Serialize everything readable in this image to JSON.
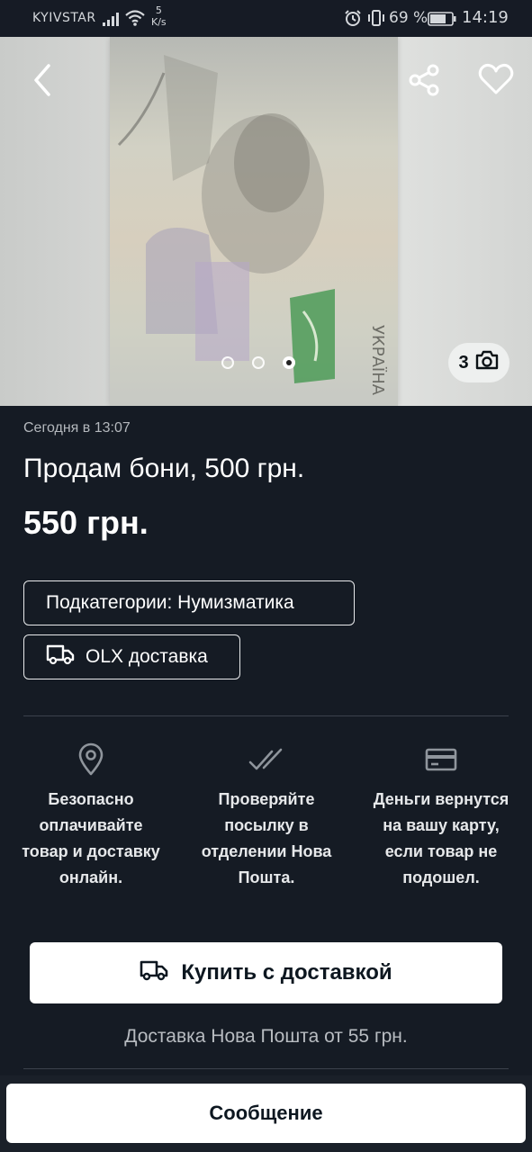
{
  "status_bar": {
    "carrier": "KYIVSTAR",
    "net_speed_value": "5",
    "net_speed_unit": "K/s",
    "battery_percent": "69 %",
    "time": "14:19"
  },
  "gallery": {
    "photo_count": "3",
    "current_index": 3,
    "total_dots": 3,
    "icons": {
      "back": "chevron-left-icon",
      "share": "share-icon",
      "favorite": "heart-icon",
      "camera": "camera-icon"
    }
  },
  "listing": {
    "posted": "Сегодня в 13:07",
    "title": "Продам бони, 500 грн.",
    "price": "550 грн."
  },
  "chips": {
    "category": "Подкатегории: Нумизматика",
    "delivery": "OLX доставка"
  },
  "features": [
    {
      "icon": "location-pin-icon",
      "text": "Безопасно оплачивайте товар и доставку онлайн."
    },
    {
      "icon": "double-check-icon",
      "text": "Проверяйте посылку в отделении Нова Пошта."
    },
    {
      "icon": "credit-card-icon",
      "text": "Деньги вернутся на вашу карту, если товар не подошел."
    }
  ],
  "actions": {
    "buy_label": "Купить с доставкой",
    "delivery_note": "Доставка Нова Пошта от 55 грн.",
    "message_label": "Сообщение"
  },
  "colors": {
    "background": "#151b24",
    "button_bg": "#ffffff",
    "button_text": "#0d1720",
    "muted_text": "#b4b8bd"
  }
}
